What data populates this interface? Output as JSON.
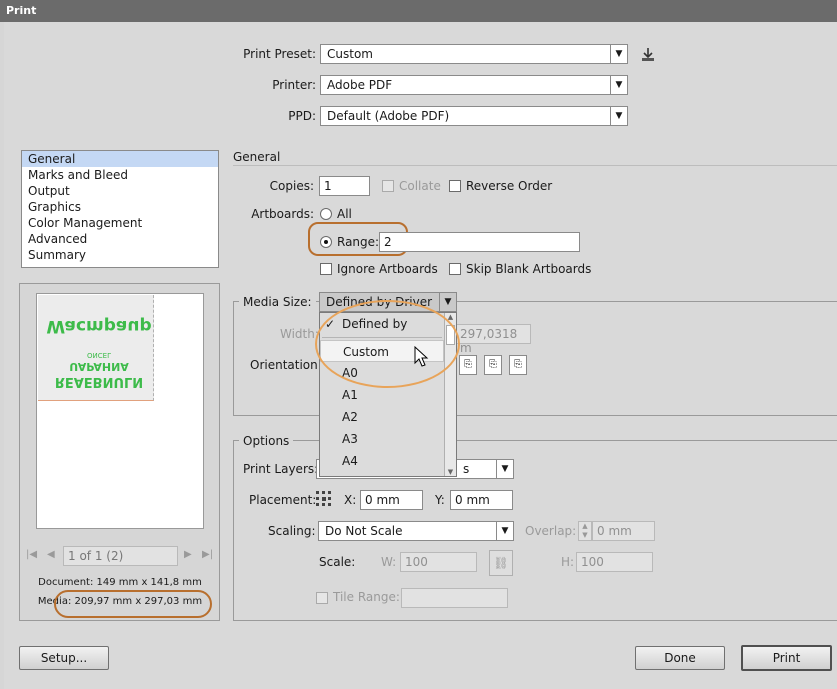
{
  "window": {
    "title": "Print"
  },
  "top": {
    "preset_label": "Print Preset:",
    "preset_value": "Custom",
    "printer_label": "Printer:",
    "printer_value": "Adobe PDF",
    "ppd_label": "PPD:",
    "ppd_value": "Default (Adobe PDF)"
  },
  "sidebar": {
    "items": [
      "General",
      "Marks and Bleed",
      "Output",
      "Graphics",
      "Color Management",
      "Advanced",
      "Summary"
    ],
    "selected": "General"
  },
  "preview": {
    "page_text": "1 of 1 (2)",
    "document": "Document: 149 mm x 141,8 mm",
    "media": "Media: 209,97 mm x 297,03 mm",
    "artwork_top": "Wacmpaup",
    "artwork_small": "ONCEL",
    "artwork_mid": "UAPAHNA",
    "artwork_bottom": "REAEBNULN"
  },
  "general": {
    "section": "General",
    "copies_label": "Copies:",
    "copies_value": "1",
    "collate": "Collate",
    "reverse_order": "Reverse Order",
    "artboards_label": "Artboards:",
    "all": "All",
    "range_label": "Range:",
    "range_value": "2",
    "ignore_artboards": "Ignore Artboards",
    "skip_blank": "Skip Blank Artboards"
  },
  "media": {
    "label": "Media Size:",
    "value": "Defined by Driver",
    "width_label": "Width:",
    "height_value": "297,0318 m",
    "orientation_label": "Orientation:",
    "dropdown": [
      "Defined by Driver",
      "Custom",
      "A0",
      "A1",
      "A2",
      "A3",
      "A4"
    ],
    "dropdown_checked": "Defined by Driver",
    "dropdown_hover": "Custom"
  },
  "options": {
    "section": "Options",
    "print_layers_label": "Print Layers:",
    "print_layers_value": "s",
    "placement_label": "Placement:",
    "x_label": "X:",
    "x_value": "0 mm",
    "y_label": "Y:",
    "y_value": "0 mm",
    "scaling_label": "Scaling:",
    "scaling_value": "Do Not Scale",
    "overlap_label": "Overlap:",
    "overlap_value": "0 mm",
    "scale_label": "Scale:",
    "w_label": "W:",
    "w_value": "100",
    "h_label": "H:",
    "h_value": "100",
    "tile_range_label": "Tile Range:"
  },
  "buttons": {
    "setup": "Setup...",
    "done": "Done",
    "print": "Print"
  },
  "colors": {
    "highlight_dark": "#b86f2e",
    "highlight_light": "#e8a45a",
    "selection": "#c4d8f4",
    "artwork_green": "#3dbb4a"
  }
}
